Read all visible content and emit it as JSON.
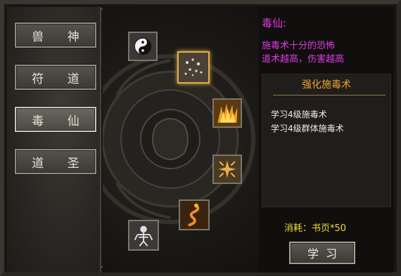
{
  "tabs": [
    {
      "label": "兽 神",
      "active": false
    },
    {
      "label": "符 道",
      "active": false
    },
    {
      "label": "毒 仙",
      "active": true
    },
    {
      "label": "道 圣",
      "active": false
    }
  ],
  "skill_nodes": [
    {
      "icon": "taiji-icon",
      "selected": false
    },
    {
      "icon": "poison-dots-icon",
      "selected": true
    },
    {
      "icon": "fire-claw-icon",
      "selected": false
    },
    {
      "icon": "rune-star-icon",
      "selected": false
    },
    {
      "icon": "serpent-icon",
      "selected": false
    },
    {
      "icon": "skeleton-icon",
      "selected": false
    }
  ],
  "info": {
    "title": "毒仙:",
    "desc1": "施毒术十分的恐怖",
    "desc2": "道术越高，伤害越高"
  },
  "skill_box": {
    "header": "强化施毒术",
    "items": [
      "学习4级施毒术",
      "学习4级群体施毒术"
    ]
  },
  "cost": "消耗：书页*50",
  "learn_button": "学习",
  "colors": {
    "accent_magenta": "#e03ae0",
    "header_orange": "#e9a53a",
    "cost_yellow": "#f2d93a"
  }
}
